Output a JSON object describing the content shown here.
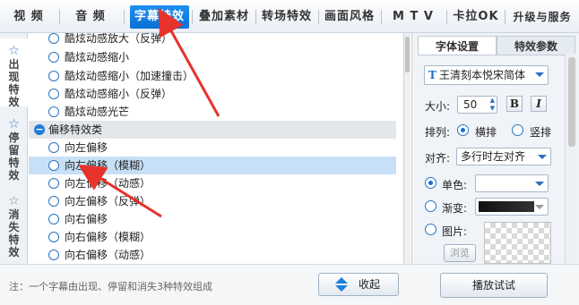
{
  "top_tabs": [
    "视 频",
    "音 频",
    "字幕特效",
    "叠加素材",
    "转场特效",
    "画面风格",
    "M T V",
    "卡拉OK",
    "升级与服务"
  ],
  "active_tab": "字幕特效",
  "side_tabs": [
    {
      "label": "出现特效",
      "icon": "star-icon"
    },
    {
      "label": "停留特效",
      "icon": "star-icon"
    },
    {
      "label": "消失特效",
      "icon": "star-icon"
    }
  ],
  "effects_list": [
    {
      "label": "酷炫动感放大（反弹）",
      "type": "item"
    },
    {
      "label": "酷炫动感缩小",
      "type": "item"
    },
    {
      "label": "酷炫动感缩小（加速撞击）",
      "type": "item"
    },
    {
      "label": "酷炫动感缩小（反弹）",
      "type": "item"
    },
    {
      "label": "酷炫动感光芒",
      "type": "item"
    },
    {
      "label": "偏移特效类",
      "type": "group"
    },
    {
      "label": "向左偏移",
      "type": "item"
    },
    {
      "label": "向左偏移（模糊）",
      "type": "item",
      "selected": true
    },
    {
      "label": "向左偏移（动感）",
      "type": "item"
    },
    {
      "label": "向左偏移（反弹）",
      "type": "item"
    },
    {
      "label": "向右偏移",
      "type": "item"
    },
    {
      "label": "向右偏移（模糊）",
      "type": "item"
    },
    {
      "label": "向右偏移（动感）",
      "type": "item"
    }
  ],
  "bottom": {
    "note": "注：一个字幕由出现、停留和消失3种特效组成",
    "collapse_label": "收起",
    "preview_label": "播放试试"
  },
  "settings": {
    "tabs": [
      "字体设置",
      "特效参数"
    ],
    "font_value": "王清刻本悦宋简体",
    "size_label": "大小:",
    "size_value": "50",
    "bold_label": "B",
    "italic_label": "I",
    "layout_label": "排列:",
    "layout_horizontal": "横排",
    "layout_vertical": "竖排",
    "align_label": "对齐:",
    "align_value": "多行时左对齐",
    "solid_label": "单色:",
    "gradient_label": "渐变:",
    "image_label": "图片:",
    "browse_label": "浏览"
  },
  "colors": {
    "accent": "#0a6fd4",
    "annotation_arrow": "#e8322c"
  }
}
